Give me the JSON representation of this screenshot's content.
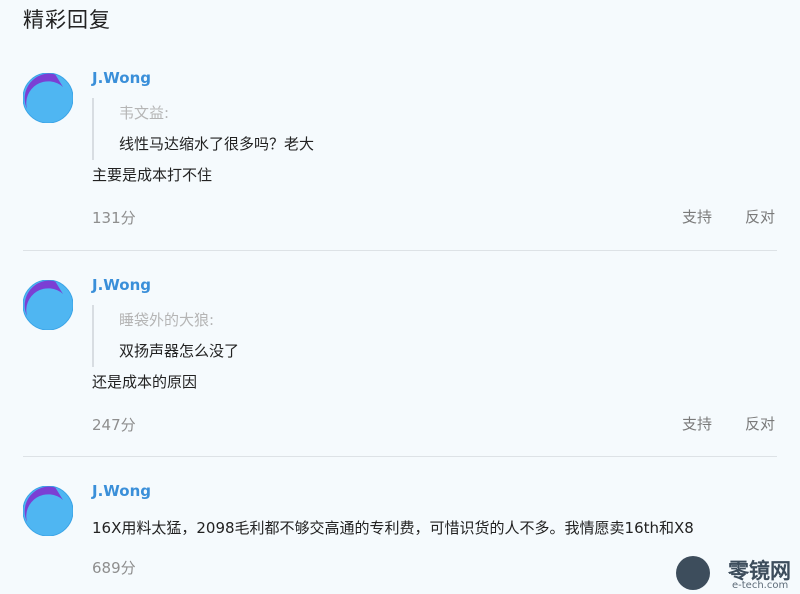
{
  "section": {
    "title": "精彩回复"
  },
  "comments": [
    {
      "author": "J.Wong",
      "quote_author": "韦文益:",
      "quote_text": "线性马达缩水了很多吗？老大",
      "reply": "主要是成本打不住",
      "score": "131分",
      "support_label": "支持",
      "oppose_label": "反对"
    },
    {
      "author": "J.Wong",
      "quote_author": "睡袋外的大狼:",
      "quote_text": "双扬声器怎么没了",
      "reply": "还是成本的原因",
      "score": "247分",
      "support_label": "支持",
      "oppose_label": "反对"
    },
    {
      "author": "J.Wong",
      "reply": "16X用料太猛，2098毛利都不够交高通的专利费，可惜识货的人不多。我情愿卖16th和X8",
      "score": "689分"
    }
  ],
  "watermark": {
    "text": "零镜网",
    "sub": "e-tech.com"
  },
  "colors": {
    "author": "#3a8fd9",
    "avatar_purple": "#7b3fd4",
    "avatar_blue": "#4fb6f2"
  },
  "icons": {
    "avatar": "avatar-icon"
  }
}
